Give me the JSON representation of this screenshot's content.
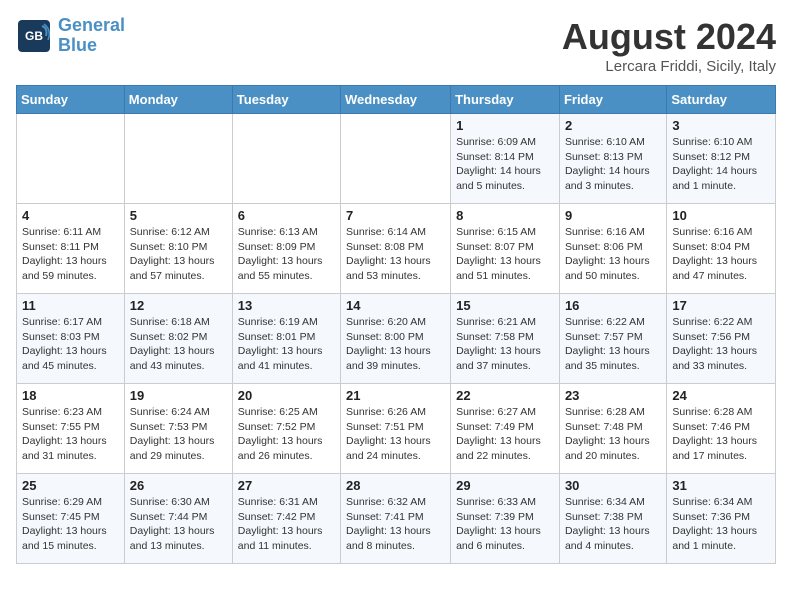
{
  "header": {
    "logo_line1": "General",
    "logo_line2": "Blue",
    "month": "August 2024",
    "location": "Lercara Friddi, Sicily, Italy"
  },
  "weekdays": [
    "Sunday",
    "Monday",
    "Tuesday",
    "Wednesday",
    "Thursday",
    "Friday",
    "Saturday"
  ],
  "weeks": [
    [
      {
        "day": "",
        "info": ""
      },
      {
        "day": "",
        "info": ""
      },
      {
        "day": "",
        "info": ""
      },
      {
        "day": "",
        "info": ""
      },
      {
        "day": "1",
        "info": "Sunrise: 6:09 AM\nSunset: 8:14 PM\nDaylight: 14 hours\nand 5 minutes."
      },
      {
        "day": "2",
        "info": "Sunrise: 6:10 AM\nSunset: 8:13 PM\nDaylight: 14 hours\nand 3 minutes."
      },
      {
        "day": "3",
        "info": "Sunrise: 6:10 AM\nSunset: 8:12 PM\nDaylight: 14 hours\nand 1 minute."
      }
    ],
    [
      {
        "day": "4",
        "info": "Sunrise: 6:11 AM\nSunset: 8:11 PM\nDaylight: 13 hours\nand 59 minutes."
      },
      {
        "day": "5",
        "info": "Sunrise: 6:12 AM\nSunset: 8:10 PM\nDaylight: 13 hours\nand 57 minutes."
      },
      {
        "day": "6",
        "info": "Sunrise: 6:13 AM\nSunset: 8:09 PM\nDaylight: 13 hours\nand 55 minutes."
      },
      {
        "day": "7",
        "info": "Sunrise: 6:14 AM\nSunset: 8:08 PM\nDaylight: 13 hours\nand 53 minutes."
      },
      {
        "day": "8",
        "info": "Sunrise: 6:15 AM\nSunset: 8:07 PM\nDaylight: 13 hours\nand 51 minutes."
      },
      {
        "day": "9",
        "info": "Sunrise: 6:16 AM\nSunset: 8:06 PM\nDaylight: 13 hours\nand 50 minutes."
      },
      {
        "day": "10",
        "info": "Sunrise: 6:16 AM\nSunset: 8:04 PM\nDaylight: 13 hours\nand 47 minutes."
      }
    ],
    [
      {
        "day": "11",
        "info": "Sunrise: 6:17 AM\nSunset: 8:03 PM\nDaylight: 13 hours\nand 45 minutes."
      },
      {
        "day": "12",
        "info": "Sunrise: 6:18 AM\nSunset: 8:02 PM\nDaylight: 13 hours\nand 43 minutes."
      },
      {
        "day": "13",
        "info": "Sunrise: 6:19 AM\nSunset: 8:01 PM\nDaylight: 13 hours\nand 41 minutes."
      },
      {
        "day": "14",
        "info": "Sunrise: 6:20 AM\nSunset: 8:00 PM\nDaylight: 13 hours\nand 39 minutes."
      },
      {
        "day": "15",
        "info": "Sunrise: 6:21 AM\nSunset: 7:58 PM\nDaylight: 13 hours\nand 37 minutes."
      },
      {
        "day": "16",
        "info": "Sunrise: 6:22 AM\nSunset: 7:57 PM\nDaylight: 13 hours\nand 35 minutes."
      },
      {
        "day": "17",
        "info": "Sunrise: 6:22 AM\nSunset: 7:56 PM\nDaylight: 13 hours\nand 33 minutes."
      }
    ],
    [
      {
        "day": "18",
        "info": "Sunrise: 6:23 AM\nSunset: 7:55 PM\nDaylight: 13 hours\nand 31 minutes."
      },
      {
        "day": "19",
        "info": "Sunrise: 6:24 AM\nSunset: 7:53 PM\nDaylight: 13 hours\nand 29 minutes."
      },
      {
        "day": "20",
        "info": "Sunrise: 6:25 AM\nSunset: 7:52 PM\nDaylight: 13 hours\nand 26 minutes."
      },
      {
        "day": "21",
        "info": "Sunrise: 6:26 AM\nSunset: 7:51 PM\nDaylight: 13 hours\nand 24 minutes."
      },
      {
        "day": "22",
        "info": "Sunrise: 6:27 AM\nSunset: 7:49 PM\nDaylight: 13 hours\nand 22 minutes."
      },
      {
        "day": "23",
        "info": "Sunrise: 6:28 AM\nSunset: 7:48 PM\nDaylight: 13 hours\nand 20 minutes."
      },
      {
        "day": "24",
        "info": "Sunrise: 6:28 AM\nSunset: 7:46 PM\nDaylight: 13 hours\nand 17 minutes."
      }
    ],
    [
      {
        "day": "25",
        "info": "Sunrise: 6:29 AM\nSunset: 7:45 PM\nDaylight: 13 hours\nand 15 minutes."
      },
      {
        "day": "26",
        "info": "Sunrise: 6:30 AM\nSunset: 7:44 PM\nDaylight: 13 hours\nand 13 minutes."
      },
      {
        "day": "27",
        "info": "Sunrise: 6:31 AM\nSunset: 7:42 PM\nDaylight: 13 hours\nand 11 minutes."
      },
      {
        "day": "28",
        "info": "Sunrise: 6:32 AM\nSunset: 7:41 PM\nDaylight: 13 hours\nand 8 minutes."
      },
      {
        "day": "29",
        "info": "Sunrise: 6:33 AM\nSunset: 7:39 PM\nDaylight: 13 hours\nand 6 minutes."
      },
      {
        "day": "30",
        "info": "Sunrise: 6:34 AM\nSunset: 7:38 PM\nDaylight: 13 hours\nand 4 minutes."
      },
      {
        "day": "31",
        "info": "Sunrise: 6:34 AM\nSunset: 7:36 PM\nDaylight: 13 hours\nand 1 minute."
      }
    ]
  ]
}
